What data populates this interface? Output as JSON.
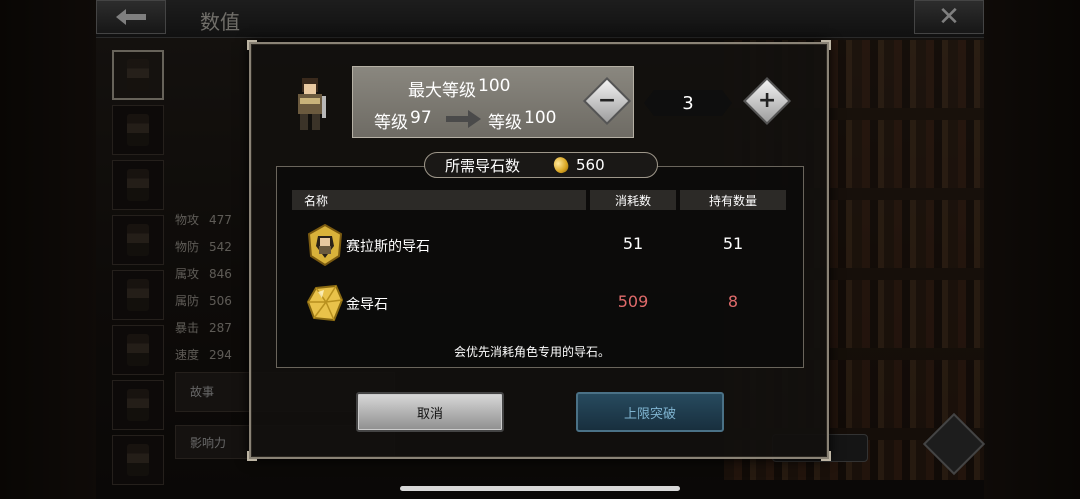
{
  "header": {
    "title": "数值"
  },
  "background": {
    "stats": [
      {
        "label": "物攻",
        "value": "477"
      },
      {
        "label": "物防",
        "value": "542"
      },
      {
        "label": "属攻",
        "value": "846"
      },
      {
        "label": "属防",
        "value": "506"
      },
      {
        "label": "暴击",
        "value": "287"
      },
      {
        "label": "速度",
        "value": "294"
      }
    ],
    "story_label": "故事",
    "influence_label": "影响力"
  },
  "dialog": {
    "max_level_label": "最大等级",
    "max_level_value": "100",
    "from_level_label": "等级",
    "from_level_value": "97",
    "to_level_label": "等级",
    "to_level_value": "100",
    "quantity": "3",
    "required_label": "所需导石数",
    "required_value": "560",
    "table": {
      "headers": {
        "name": "名称",
        "cost": "消耗数",
        "owned": "持有数量"
      },
      "rows": [
        {
          "name": "赛拉斯的导石",
          "cost": "51",
          "owned": "51",
          "icon": "character-stone-icon"
        },
        {
          "name": "金导石",
          "cost": "509",
          "owned": "8",
          "icon": "gold-stone-icon",
          "highlight": "#e06b6b"
        }
      ]
    },
    "hint": "会优先消耗角色专用的导石。",
    "cancel_label": "取消",
    "confirm_label": "上限突破"
  }
}
